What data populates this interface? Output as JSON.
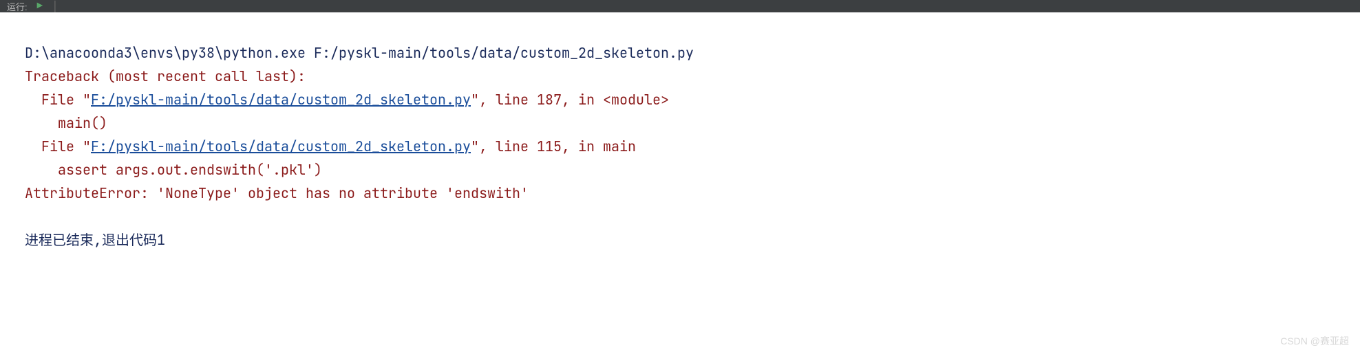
{
  "toolbar": {
    "label": "运行:",
    "play_icon": "play-icon"
  },
  "console": {
    "command": "D:\\anacoonda3\\envs\\py38\\python.exe F:/pyskl-main/tools/data/custom_2d_skeleton.py",
    "traceback_header": "Traceback (most recent call last):",
    "frame1_prefix": "  File \"",
    "frame1_path": "F:/pyskl-main/tools/data/custom_2d_skeleton.py",
    "frame1_suffix": "\", line 187, in <module>",
    "frame1_code": "    main()",
    "frame2_prefix": "  File \"",
    "frame2_path": "F:/pyskl-main/tools/data/custom_2d_skeleton.py",
    "frame2_suffix": "\", line 115, in main",
    "frame2_code": "    assert args.out.endswith('.pkl')",
    "error": "AttributeError: 'NoneType' object has no attribute 'endswith'",
    "exit_message": "进程已结束,退出代码1"
  },
  "watermark": "CSDN @赛亚超"
}
